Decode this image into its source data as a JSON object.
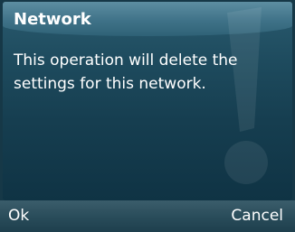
{
  "dialog": {
    "title": "Network",
    "message": "This operation will delete the settings for this network.",
    "icon": "exclamation-icon"
  },
  "softkeys": {
    "left_label": "Ok",
    "right_label": "Cancel"
  },
  "colors": {
    "dialog_background": "#1e4b5e",
    "header_background": "#3f7288",
    "softkey_bar_background": "#2a4d5b",
    "text": "#ffffff"
  }
}
